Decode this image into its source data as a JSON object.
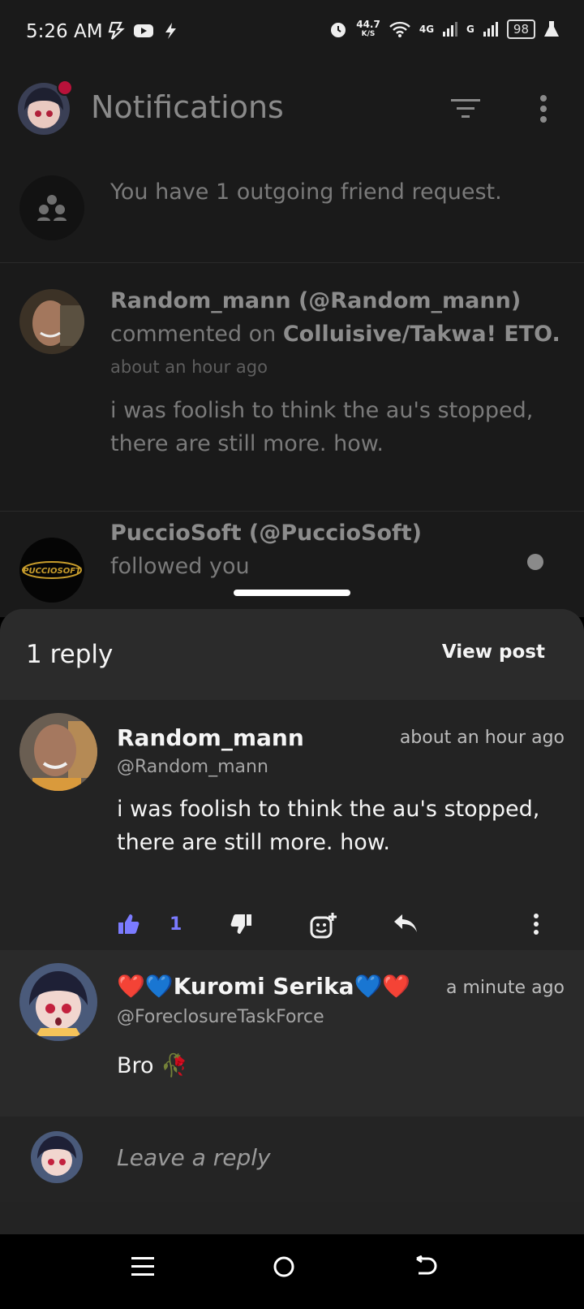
{
  "status_bar": {
    "time": "5:26 AM",
    "net_speed_value": "44.7",
    "net_speed_unit": "K/S",
    "network_4g": "4G",
    "network_g": "G",
    "battery": "98"
  },
  "app_bar": {
    "title": "Notifications",
    "icons": [
      "avatar",
      "filter-icon",
      "more-vert-icon"
    ]
  },
  "notifications": [
    {
      "type": "friend_request",
      "text": "You have 1 outgoing friend request."
    },
    {
      "type": "comment",
      "user": "Random_mann (@Random_mann)",
      "action": "commented on",
      "target": "Colluisive/Takwa! ETO.",
      "time": "about an hour ago",
      "preview": "i was foolish to think the au's stopped, there are still more. how."
    },
    {
      "type": "follow",
      "user": "PuccioSoft (@PuccioSoft)",
      "action": "followed you",
      "logo_text": "PUCCIOSOFT"
    }
  ],
  "sheet": {
    "reply_count": "1 reply",
    "view_post": "View post",
    "main_comment": {
      "name": "Random_mann",
      "handle": "@Random_mann",
      "time": "about an hour ago",
      "body": "i was foolish to think the au's stopped, there are still more. how.",
      "likes": "1"
    },
    "reply": {
      "name": "❤️💙Kuromi Serika💙❤️",
      "handle": "@ForeclosureTaskForce",
      "time": "a minute ago",
      "body": "Bro 🥀"
    },
    "reply_placeholder": "Leave a reply"
  },
  "colors": {
    "accent": "#7b7bff",
    "badge": "#b8123a",
    "sheet_bg": "#232323"
  }
}
